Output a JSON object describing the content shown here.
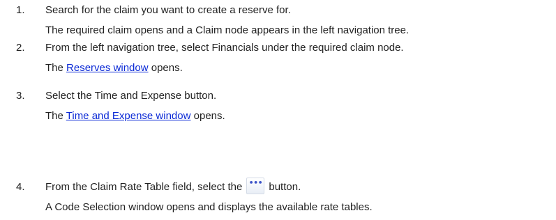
{
  "steps": [
    {
      "number": "1.",
      "line1": "Search for the claim you want to create a reserve for.",
      "line2": "The required claim opens and a Claim node appears in the left navigation tree."
    },
    {
      "number": "2.",
      "line1": "From the left navigation tree, select Financials under the required claim node.",
      "line2_prefix": "The ",
      "line2_link": "Reserves window",
      "line2_suffix": " opens."
    },
    {
      "number": "3.",
      "line1": "Select the Time and Expense button.",
      "line2_prefix": "The ",
      "line2_link": "Time and Expense window",
      "line2_suffix": " opens."
    },
    {
      "number": "4.",
      "line1_prefix": "From the Claim Rate Table field, select the",
      "line1_button": "•••",
      "line1_suffix": "button.",
      "line2": "A Code Selection window opens and displays the available rate tables."
    }
  ],
  "colors": {
    "text": "#222222",
    "link": "#0b2ad6",
    "button_dots": "#3d55c9"
  },
  "icons": {
    "ellipsis_button": "ellipsis-icon"
  }
}
